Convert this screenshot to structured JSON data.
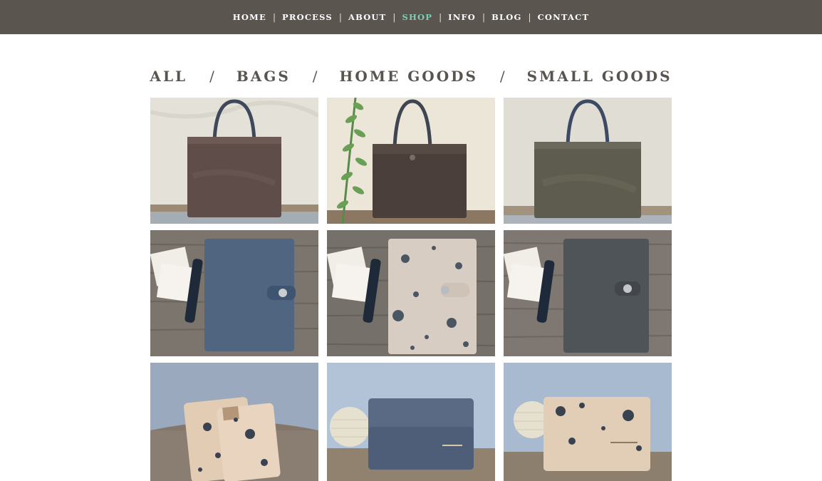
{
  "nav": {
    "items": [
      {
        "label": "HOME",
        "active": false
      },
      {
        "label": "PROCESS",
        "active": false
      },
      {
        "label": "ABOUT",
        "active": false
      },
      {
        "label": "SHOP",
        "active": true
      },
      {
        "label": "INFO",
        "active": false
      },
      {
        "label": "BLOG",
        "active": false
      },
      {
        "label": "CONTACT",
        "active": false
      }
    ],
    "separator": "|",
    "active_color": "#7ccfb4",
    "bar_color": "#5b5550"
  },
  "filters": {
    "items": [
      "ALL",
      "BAGS",
      "HOME GOODS",
      "SMALL GOODS"
    ],
    "separator": "/"
  },
  "products": [
    {
      "kind": "tote-bag",
      "color": "#5e4d49"
    },
    {
      "kind": "tote-bag-plant",
      "color": "#4a3f3a"
    },
    {
      "kind": "tote-bag",
      "color": "#5d5c4f"
    },
    {
      "kind": "journal-cover",
      "color": "#4f6580"
    },
    {
      "kind": "journal-cover-splatter",
      "color": "#d8cdc3"
    },
    {
      "kind": "journal-cover",
      "color": "#4f5459"
    },
    {
      "kind": "card-sleeve-splatter",
      "color": "#e3ccb4"
    },
    {
      "kind": "card-wallet",
      "color": "#5a6a85"
    },
    {
      "kind": "card-wallet-splatter",
      "color": "#e2cdb6"
    }
  ]
}
